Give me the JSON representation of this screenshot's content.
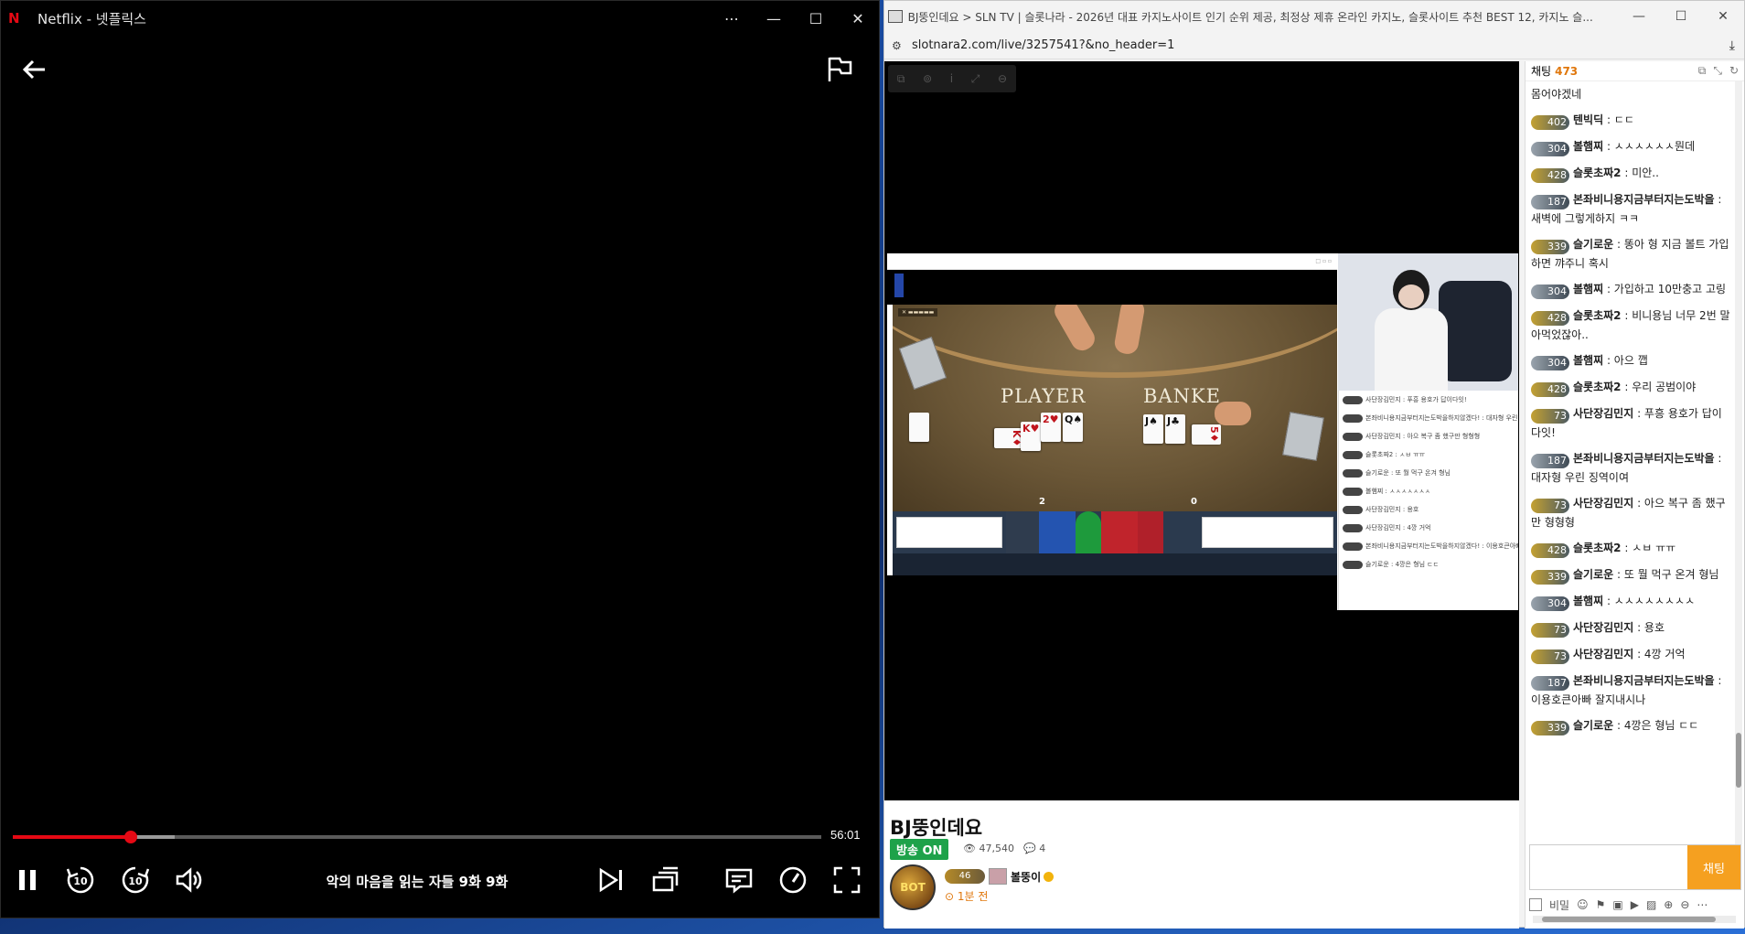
{
  "netflix": {
    "logo": "N",
    "window_title": "Netflix - 넷플릭스",
    "window_buttons": {
      "more": "⋯",
      "minimize": "—",
      "maximize": "☐",
      "close": "✕"
    },
    "episode_title": "악의 마음을 읽는 자들 9화  9화",
    "time_remaining": "56:01",
    "progress_fraction": 0.146,
    "buffered_fraction": 0.2,
    "icons": [
      "back-arrow-icon",
      "report-flag-icon",
      "pause-icon",
      "rewind-10-icon",
      "forward-10-icon",
      "volume-icon",
      "next-episode-icon",
      "episodes-icon",
      "subtitles-icon",
      "playback-speed-icon",
      "fullscreen-icon"
    ],
    "skip_seconds": "10"
  },
  "browser": {
    "window_title": "BJ뚱인데요 > SLN TV | 슬롯나라 - 2026년 대표 카지노사이트 인기 순위 제공, 최정상 제휴 온라인 카지노, 슬롯사이트 추천 BEST 12, 카지노 슬...",
    "url": "slotnara2.com/live/3257541?&no_header=1",
    "window_buttons": {
      "minimize": "—",
      "maximize": "☐",
      "close": "✕"
    },
    "stream": {
      "player_label": "PLAYER",
      "banker_label": "BANKE",
      "player_score": "2",
      "banker_score": "0",
      "player_cards": [
        "K♦",
        "K♥",
        "2♥",
        "Q♠"
      ],
      "banker_cards": [
        "J♠",
        "J♣",
        "5♦"
      ],
      "mini_chat": [
        "사단장김민지 : 푸흥 용호가 답이다잇!",
        "본좌비니용지금부터지는도박을하지않겠다! : 대자형 우린 징역이여",
        "사단장김민지 : 아으 복구 좀 했구만 형형형",
        "슬롯초짜2 : ㅅㅂ ㅠㅠ",
        "슬기로운 : 또 뭘 먹구 온겨 형님",
        "볼햄찌 : ㅅㅅㅅㅅㅅㅅㅅ",
        "사단장김민지 : 용호",
        "사단장김민지 : 4깡 거억",
        "본좌비니용지금부터지는도박을하지않겠다! : 이용호큰아빠 잘지내시나",
        "슬기로운 : 4깡은 형님 ㄷㄷ"
      ]
    },
    "info": {
      "bj_name": "BJ뚱인데요",
      "live_badge": "방송 ON",
      "viewers": "47,540",
      "comments": "4",
      "streamer_level": "46",
      "streamer_nick": "볼뚱이",
      "time_ago": "1분 전",
      "avatar_text": "BOT"
    },
    "chat": {
      "header_label": "채팅",
      "user_count": "473",
      "messages": [
        {
          "level": "",
          "nick": "",
          "text": "몸어야겠네"
        },
        {
          "level": "402",
          "nick": "텐빅딕",
          "text": "ㄷㄷ"
        },
        {
          "level": "304",
          "nick": "볼햄찌",
          "text": "ㅅㅅㅅㅅㅅㅅ뭔데"
        },
        {
          "level": "428",
          "nick": "슬롯초짜2",
          "text": "미안.."
        },
        {
          "level": "187",
          "nick": "본좌비니용지금부터지는도박을",
          "text": "새벽에 그렇게하지 ㅋㅋ"
        },
        {
          "level": "339",
          "nick": "슬기로운",
          "text": "똥아 형 지금 볼트 가입하면 꺄주니 혹시"
        },
        {
          "level": "304",
          "nick": "볼햄찌",
          "text": "가입하고 10만충고 고링"
        },
        {
          "level": "428",
          "nick": "슬롯초짜2",
          "text": "비니용님 너무 2번 말아먹었잖아.."
        },
        {
          "level": "304",
          "nick": "볼햄찌",
          "text": "아으 깹"
        },
        {
          "level": "428",
          "nick": "슬롯초짜2",
          "text": "우리 공범이야"
        },
        {
          "level": "73",
          "nick": "사단장김민지",
          "text": "푸흥 용호가 답이다잇!"
        },
        {
          "level": "187",
          "nick": "본좌비니용지금부터지는도박을",
          "text": "대자형 우린 징역이여"
        },
        {
          "level": "73",
          "nick": "사단장김민지",
          "text": "아으 복구 좀 했구만 형형형"
        },
        {
          "level": "428",
          "nick": "슬롯초짜2",
          "text": "ㅅㅂ ㅠㅠ"
        },
        {
          "level": "339",
          "nick": "슬기로운",
          "text": "또 뭘 먹구 온겨 형님"
        },
        {
          "level": "304",
          "nick": "볼햄찌",
          "text": "ㅅㅅㅅㅅㅅㅅㅅㅅ"
        },
        {
          "level": "73",
          "nick": "사단장김민지",
          "text": "용호"
        },
        {
          "level": "73",
          "nick": "사단장김민지",
          "text": "4깡 거억"
        },
        {
          "level": "187",
          "nick": "본좌비니용지금부터지는도박을",
          "text": "이용호큰아빠 잘지내시나"
        },
        {
          "level": "339",
          "nick": "슬기로운",
          "text": "4깡은 형님 ㄷㄷ"
        }
      ],
      "send_label": "채팅",
      "secret_label": "비밀",
      "input_placeholder": "",
      "scroll_fraction": 0.92
    }
  }
}
